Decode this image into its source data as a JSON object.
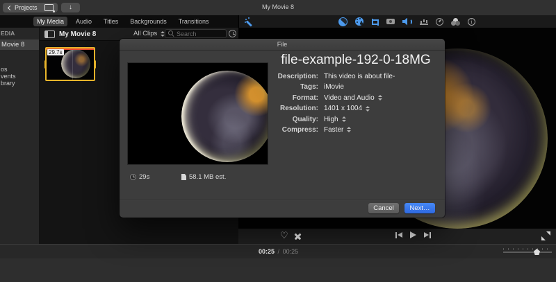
{
  "window_title": "My Movie 8",
  "top_toolbar": {
    "projects": "Projects"
  },
  "media_tabs": {
    "items": [
      "My Media",
      "Audio",
      "Titles",
      "Backgrounds",
      "Transitions"
    ],
    "selected": "My Media"
  },
  "sidebar": {
    "section_fragment": "EDIA",
    "selected_item": "Movie 8",
    "items": [
      "os",
      "vents",
      "brary"
    ]
  },
  "browser": {
    "title": "My Movie 8",
    "filter": "All Clips",
    "search_placeholder": "Search",
    "clip_duration_badge": "29.7s"
  },
  "dialog": {
    "title": "File",
    "file_name": "file-example-192-0-18MG",
    "fields": [
      {
        "label": "Description:",
        "value": "This video is about file-"
      },
      {
        "label": "Tags:",
        "value": "iMovie"
      },
      {
        "label": "Format:",
        "value": "Video and Audio"
      },
      {
        "label": "Resolution:",
        "value": "1401 x 1004"
      },
      {
        "label": "Quality:",
        "value": "High"
      },
      {
        "label": "Compress:",
        "value": "Faster"
      }
    ],
    "duration": "29s",
    "size_estimate": "58.1 MB est.",
    "cancel": "Cancel",
    "next": "Next…"
  },
  "playback": {
    "elapsed": "00:25",
    "divider": "/",
    "duration": "00:25"
  },
  "icons": {
    "heart": "♡",
    "down_arrow": "↓",
    "info": "i"
  },
  "colors": {
    "accent_blue": "#4f9ef2",
    "next_button_blue": "#3a78ee",
    "selection_yellow": "#eab62b",
    "clip_marker_red": "#e8452e"
  }
}
